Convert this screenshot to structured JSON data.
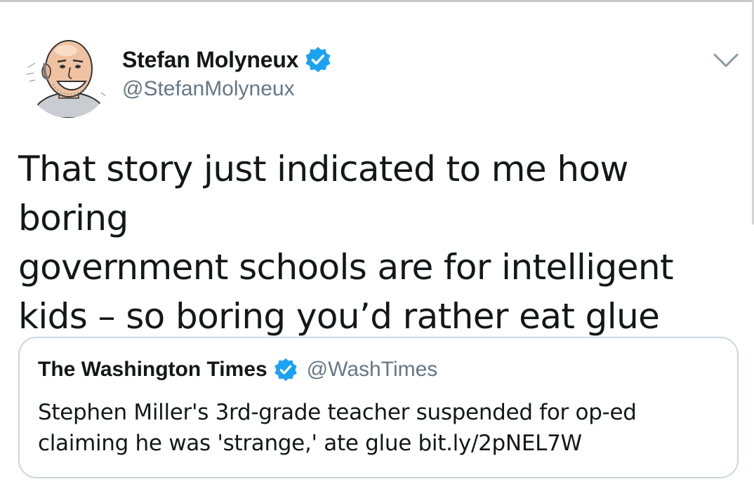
{
  "tweet": {
    "author": {
      "name": "Stefan Molyneux",
      "handle": "@StefanMolyneux",
      "verified": true,
      "avatar_icon": "caricature-avatar-icon"
    },
    "menu_icon": "chevron-down-icon",
    "text": "That story just indicated to me how boring\ngovernment schools are for intelligent\nkids – so boring you’d rather eat glue",
    "quoted_tweet": {
      "author_name": "The Washington Times",
      "author_handle": "@WashTimes",
      "verified": true,
      "text": "Stephen Miller's 3rd-grade teacher suspended for op-ed\nclaiming he was 'strange,' ate glue bit.ly/2pNEL7W"
    }
  },
  "colors": {
    "text_primary": "#14171a",
    "text_secondary": "#657786",
    "verified_blue": "#1da1f2",
    "card_border": "#ccd6dd",
    "chevron": "#8899a6"
  }
}
